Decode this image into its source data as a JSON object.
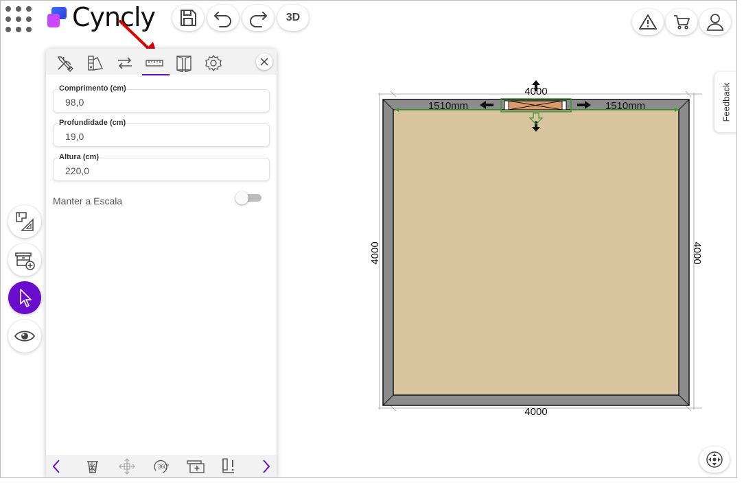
{
  "header": {
    "logo_text": "Cyncly",
    "view_3d_label": "3D"
  },
  "icons": {
    "apps": "apps-grid-icon",
    "save": "save-icon",
    "undo": "undo-icon",
    "redo": "redo-icon",
    "warning": "warning-icon",
    "cart": "cart-icon",
    "user": "user-icon"
  },
  "panel": {
    "tabs": [
      "tools-icon",
      "materials-icon",
      "swap-icon",
      "ruler-icon",
      "door-icon",
      "settings-icon"
    ],
    "active_tab": "ruler-icon",
    "fields": [
      {
        "label": "Comprimento (cm)",
        "value": "98,0"
      },
      {
        "label": "Profundidade (cm)",
        "value": "19,0"
      },
      {
        "label": "Altura (cm)",
        "value": "220,0"
      }
    ],
    "keep_scale_label": "Manter a Escala",
    "keep_scale_on": false
  },
  "plan": {
    "top_dimension": "4000",
    "bottom_dimension": "4000",
    "left_dimension": "4000",
    "right_dimension": "4000",
    "left_offset": "1510mm",
    "right_offset": "1510mm"
  },
  "feedback_label": "Feedback",
  "colors": {
    "accent": "#6a0dcc",
    "floor": "#d9c4a0",
    "wall": "#8c8c8c",
    "door": "#d99a6c",
    "annotation_arrow": "#e00000",
    "guide_line": "#3a9a2a"
  }
}
